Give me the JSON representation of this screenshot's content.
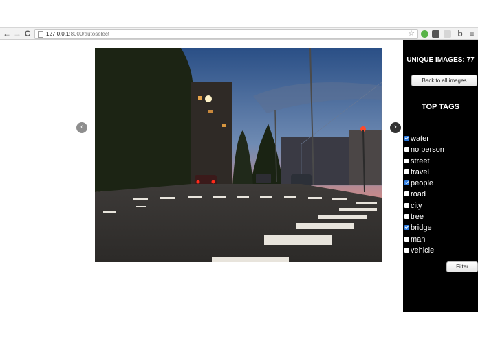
{
  "browser": {
    "url_host": "127.0.0.1",
    "url_path": ":8000/autoselect",
    "back_icon": "←",
    "forward_icon": "→",
    "reload_icon": "C",
    "star_icon": "☆",
    "menu_icon": "≡",
    "ext_colors": [
      "#58b348",
      "#555555",
      "#bdbdbd",
      "#d9d9d9"
    ],
    "ext_bing_icon": "b"
  },
  "carousel": {
    "prev_icon": "‹",
    "next_icon": "›"
  },
  "sidebar": {
    "count_label": "UNIQUE IMAGES: 77",
    "back_button": "Back to all images",
    "tags_heading": "TOP TAGS",
    "tags": [
      {
        "label": "water",
        "checked": true
      },
      {
        "label": "no person",
        "checked": false
      },
      {
        "label": "street",
        "checked": false
      },
      {
        "label": "travel",
        "checked": false
      },
      {
        "label": "people",
        "checked": true
      },
      {
        "label": "road",
        "checked": false
      },
      {
        "label": "city",
        "checked": false
      },
      {
        "label": "tree",
        "checked": false
      },
      {
        "label": "bridge",
        "checked": true
      },
      {
        "label": "man",
        "checked": false
      },
      {
        "label": "vehicle",
        "checked": false
      }
    ],
    "filter_button": "Filter"
  }
}
